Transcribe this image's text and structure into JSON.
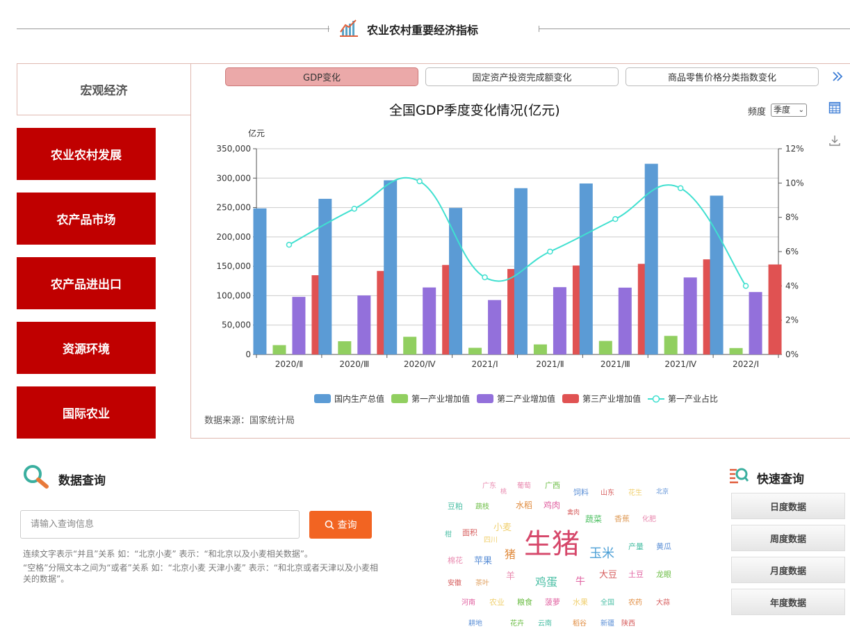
{
  "header": {
    "title": "农业农村重要经济指标"
  },
  "nav": {
    "macro": "宏观经济",
    "items": [
      "农业农村发展",
      "农产品市场",
      "农产品进出口",
      "资源环境",
      "国际农业"
    ]
  },
  "tabs": [
    "GDP变化",
    "固定资产投资完成额变化",
    "商品零售价格分类指数变化"
  ],
  "frequency": {
    "label": "频度",
    "value": "季度"
  },
  "source": "数据来源：国家统计局",
  "chart_data": {
    "type": "bar",
    "title": "全国GDP季度变化情况(亿元)",
    "ylabel": "亿元",
    "categories": [
      "2020/Ⅱ",
      "2020/Ⅲ",
      "2020/Ⅳ",
      "2021/Ⅰ",
      "2021/Ⅱ",
      "2021/Ⅲ",
      "2021/Ⅳ",
      "2022/Ⅰ"
    ],
    "ylim": [
      0,
      350000
    ],
    "y_ticks": [
      "0",
      "50,000",
      "100,000",
      "150,000",
      "200,000",
      "250,000",
      "300,000",
      "350,000"
    ],
    "y2lim": [
      0,
      12
    ],
    "y2_ticks": [
      "0%",
      "2%",
      "4%",
      "6%",
      "8%",
      "10%",
      "12%"
    ],
    "series": [
      {
        "name": "国内生产总值",
        "type": "bar",
        "color": "#5b9bd5",
        "values": [
          248500,
          264800,
          296300,
          249300,
          282900,
          290900,
          324400,
          270200
        ]
      },
      {
        "name": "第一产业增加值",
        "type": "bar",
        "color": "#91cf60",
        "values": [
          15900,
          22500,
          30100,
          11300,
          17100,
          23000,
          31600,
          10900
        ]
      },
      {
        "name": "第二产业增加值",
        "type": "bar",
        "color": "#9370db",
        "values": [
          98000,
          100400,
          114000,
          92600,
          114500,
          113700,
          131000,
          106200
        ]
      },
      {
        "name": "第三产业增加值",
        "type": "bar",
        "color": "#e05252",
        "values": [
          134800,
          142100,
          152200,
          145400,
          151300,
          154200,
          161800,
          153100
        ]
      },
      {
        "name": "第一产业占比",
        "type": "line",
        "axis": "right",
        "color": "#40e0d0",
        "values": [
          6.4,
          8.5,
          10.1,
          4.5,
          6.0,
          7.9,
          9.7,
          4.0
        ]
      }
    ],
    "legend_position": "bottom",
    "grid": true
  },
  "query": {
    "title": "数据查询",
    "placeholder": "请输入查询信息",
    "button": "查询",
    "hint1": "连续文字表示“并且”关系 如：“北京小麦” 表示：“和北京以及小麦相关数据”。",
    "hint2": "“空格”分隔文本之间为“或者”关系 如：“北京小麦 天津小麦” 表示：“和北京或者天津以及小麦相关的数据”。"
  },
  "quick": {
    "title": "快速查询",
    "items": [
      "日度数据",
      "周度数据",
      "月度数据",
      "年度数据"
    ]
  },
  "wordcloud": [
    {
      "t": "广东",
      "c": "#e98bb0"
    },
    {
      "t": "葡萄",
      "c": "#e98bb0"
    },
    {
      "t": "广西",
      "c": "#6cbd45"
    },
    {
      "t": "桃",
      "c": "#e98bb0"
    },
    {
      "t": "饲料",
      "c": "#5b8fd6"
    },
    {
      "t": "山东",
      "c": "#d65b5b"
    },
    {
      "t": "花生",
      "c": "#f0d070"
    },
    {
      "t": "北京",
      "c": "#5b8fd6"
    },
    {
      "t": "豆粕",
      "c": "#4bbfa5"
    },
    {
      "t": "蔬枝",
      "c": "#6cbd45"
    },
    {
      "t": "水稻",
      "c": "#e08a3c"
    },
    {
      "t": "鸡肉",
      "c": "#e060a0"
    },
    {
      "t": "禽肉",
      "c": "#d65b5b"
    },
    {
      "t": "蔬菜",
      "c": "#4bbf60"
    },
    {
      "t": "香蕉",
      "c": "#e0a060"
    },
    {
      "t": "化肥",
      "c": "#e98bb0"
    },
    {
      "t": "小麦",
      "c": "#f0d070"
    },
    {
      "t": "柑",
      "c": "#4bbfa5"
    },
    {
      "t": "面积",
      "c": "#d65b5b"
    },
    {
      "t": "四川",
      "c": "#f0d070"
    },
    {
      "t": "生猪",
      "c": "#d6476a"
    },
    {
      "t": "玉米",
      "c": "#4b9fd6"
    },
    {
      "t": "产量",
      "c": "#4bbfa5"
    },
    {
      "t": "黄瓜",
      "c": "#5b8fd6"
    },
    {
      "t": "猪",
      "c": "#e08a3c"
    },
    {
      "t": "棉花",
      "c": "#e98bb0"
    },
    {
      "t": "苹果",
      "c": "#5b8fd6"
    },
    {
      "t": "羊",
      "c": "#e98bb0"
    },
    {
      "t": "鸡蛋",
      "c": "#4bbfa5"
    },
    {
      "t": "牛",
      "c": "#e060a0"
    },
    {
      "t": "大豆",
      "c": "#d65b5b"
    },
    {
      "t": "土豆",
      "c": "#e060a0"
    },
    {
      "t": "龙眼",
      "c": "#6cbd45"
    },
    {
      "t": "安徽",
      "c": "#d65b5b"
    },
    {
      "t": "茶叶",
      "c": "#e0a060"
    },
    {
      "t": "河南",
      "c": "#e060a0"
    },
    {
      "t": "农业",
      "c": "#f0d070"
    },
    {
      "t": "粮食",
      "c": "#6cbd45"
    },
    {
      "t": "菠萝",
      "c": "#e060a0"
    },
    {
      "t": "水果",
      "c": "#f0d070"
    },
    {
      "t": "全国",
      "c": "#4bbfa5"
    },
    {
      "t": "农药",
      "c": "#e08a3c"
    },
    {
      "t": "大蒜",
      "c": "#d65b5b"
    },
    {
      "t": "耕地",
      "c": "#5b8fd6"
    },
    {
      "t": "花卉",
      "c": "#6cbd45"
    },
    {
      "t": "云南",
      "c": "#4bbfa5"
    },
    {
      "t": "稻谷",
      "c": "#e08a3c"
    },
    {
      "t": "新疆",
      "c": "#5b8fd6"
    },
    {
      "t": "陕西",
      "c": "#d65b5b"
    }
  ]
}
